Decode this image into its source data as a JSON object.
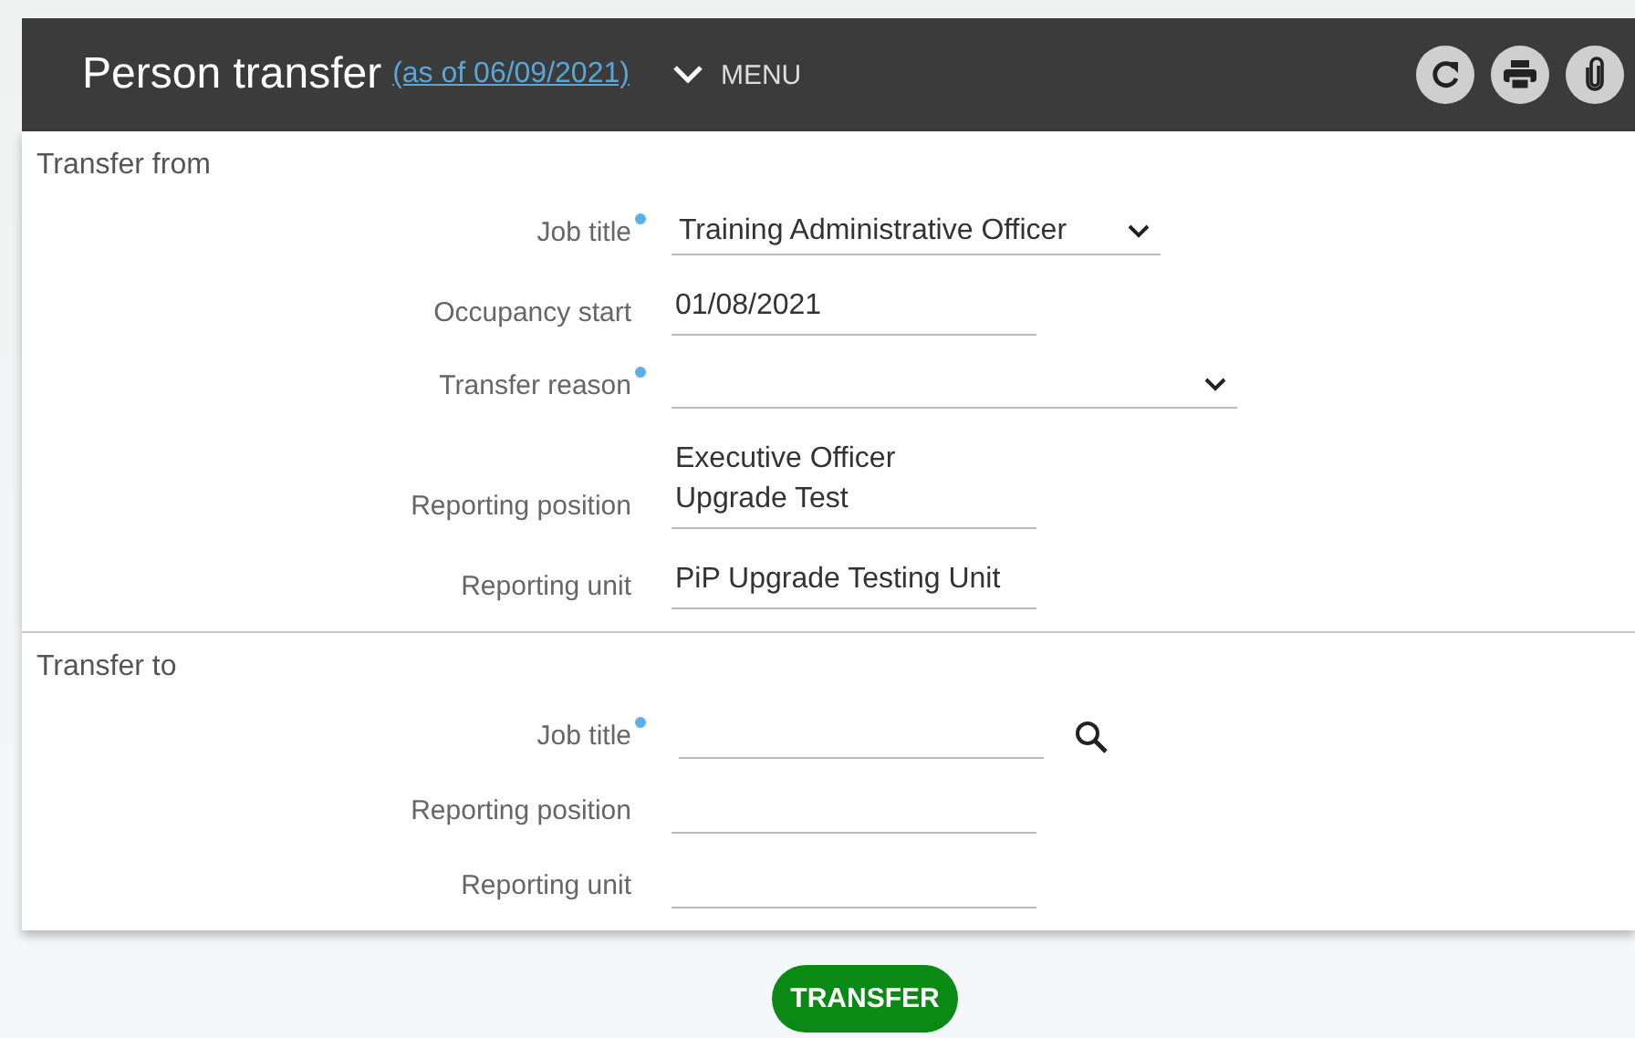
{
  "header": {
    "title": "Person transfer",
    "as_of": "(as of 06/09/2021)",
    "menu": "MENU"
  },
  "sections": [
    {
      "title": "Transfer from",
      "fields": [
        {
          "label": "Job title",
          "required": true,
          "kind": "select",
          "value": "Training Administrative Officer"
        },
        {
          "label": "Occupancy start",
          "required": false,
          "kind": "text",
          "value": "01/08/2021"
        },
        {
          "label": "Transfer reason",
          "required": true,
          "kind": "select"
        },
        {
          "label": "Reporting position",
          "required": false,
          "kind": "text",
          "value": "Executive Officer\nUpgrade Test"
        },
        {
          "label": "Reporting unit",
          "required": false,
          "kind": "text",
          "value": "PiP Upgrade Testing Unit"
        }
      ]
    },
    {
      "title": "Transfer to",
      "fields": [
        {
          "label": "Job title",
          "required": true,
          "kind": "lookup"
        },
        {
          "label": "Reporting position",
          "required": false,
          "kind": "text"
        },
        {
          "label": "Reporting unit",
          "required": false,
          "kind": "text"
        }
      ]
    }
  ],
  "button": "TRANSFER"
}
